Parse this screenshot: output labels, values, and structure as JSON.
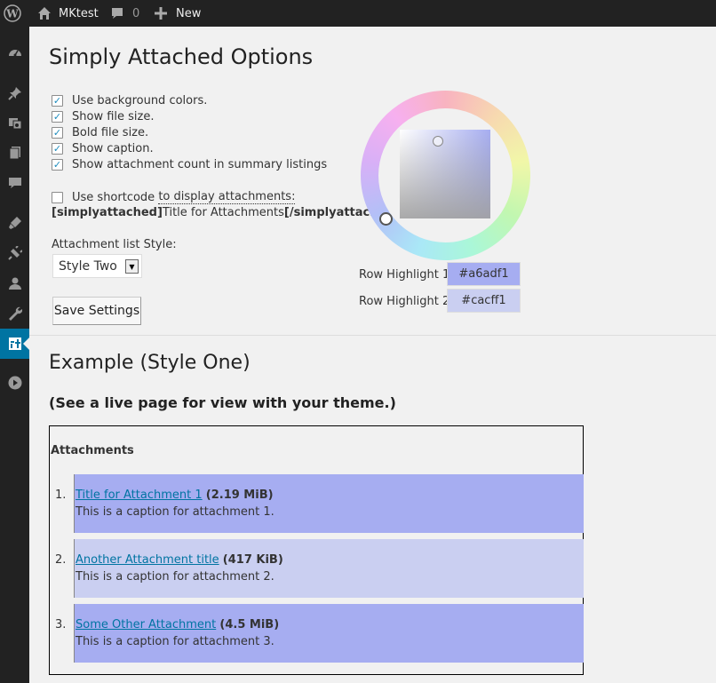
{
  "adminbar": {
    "site_name": "MKtest",
    "comments_count": "0",
    "new_label": "New"
  },
  "menu": {
    "icons": [
      "dashboard-icon",
      "pin-icon",
      "media-icon",
      "pages-icon",
      "comments-icon",
      "appearance-icon",
      "plugins-icon",
      "users-icon",
      "tools-icon",
      "settings-icon",
      "collapse-icon"
    ],
    "current": "settings-icon"
  },
  "page": {
    "title": "Simply Attached Options",
    "options": [
      {
        "label": "Use background colors.",
        "checked": true
      },
      {
        "label": "Show file size.",
        "checked": true
      },
      {
        "label": "Bold file size.",
        "checked": true
      },
      {
        "label": "Show caption.",
        "checked": true
      },
      {
        "label": "Show attachment count in summary listings",
        "checked": true
      }
    ],
    "shortcode": {
      "label_pre": "Use shortcode ",
      "label_link": "to display attachments:",
      "checked": false,
      "open_tag": "[simplyattached]",
      "inner": "Title for Attachments",
      "close_tag": "[/simplyattached]"
    },
    "list_style_label": "Attachment list Style:",
    "list_style_value": "Style Two",
    "save_label": "Save Settings",
    "row_highlight_1_label": "Row Highlight 1:",
    "row_highlight_1_value": "#a6adf1",
    "row_highlight_2_label": "Row Highlight 2:",
    "row_highlight_2_value": "#cacff1"
  },
  "example": {
    "title": "Example (Style One)",
    "note": "(See a live page for view with your theme.)",
    "heading": "Attachments",
    "items": [
      {
        "num": "1.",
        "title": "Title for Attachment 1",
        "size": "(2.19 MiB)",
        "caption": "This is a caption for attachment 1."
      },
      {
        "num": "2.",
        "title": "Another Attachment title",
        "size": "(417 KiB)",
        "caption": "This is a caption for attachment 2."
      },
      {
        "num": "3.",
        "title": "Some Other Attachment",
        "size": "(4.5 MiB)",
        "caption": "This is a caption for attachment 3."
      }
    ]
  },
  "colors": {
    "highlight_1": "#a6adf1",
    "highlight_2": "#cacff1",
    "admin_blue": "#0074a2"
  }
}
